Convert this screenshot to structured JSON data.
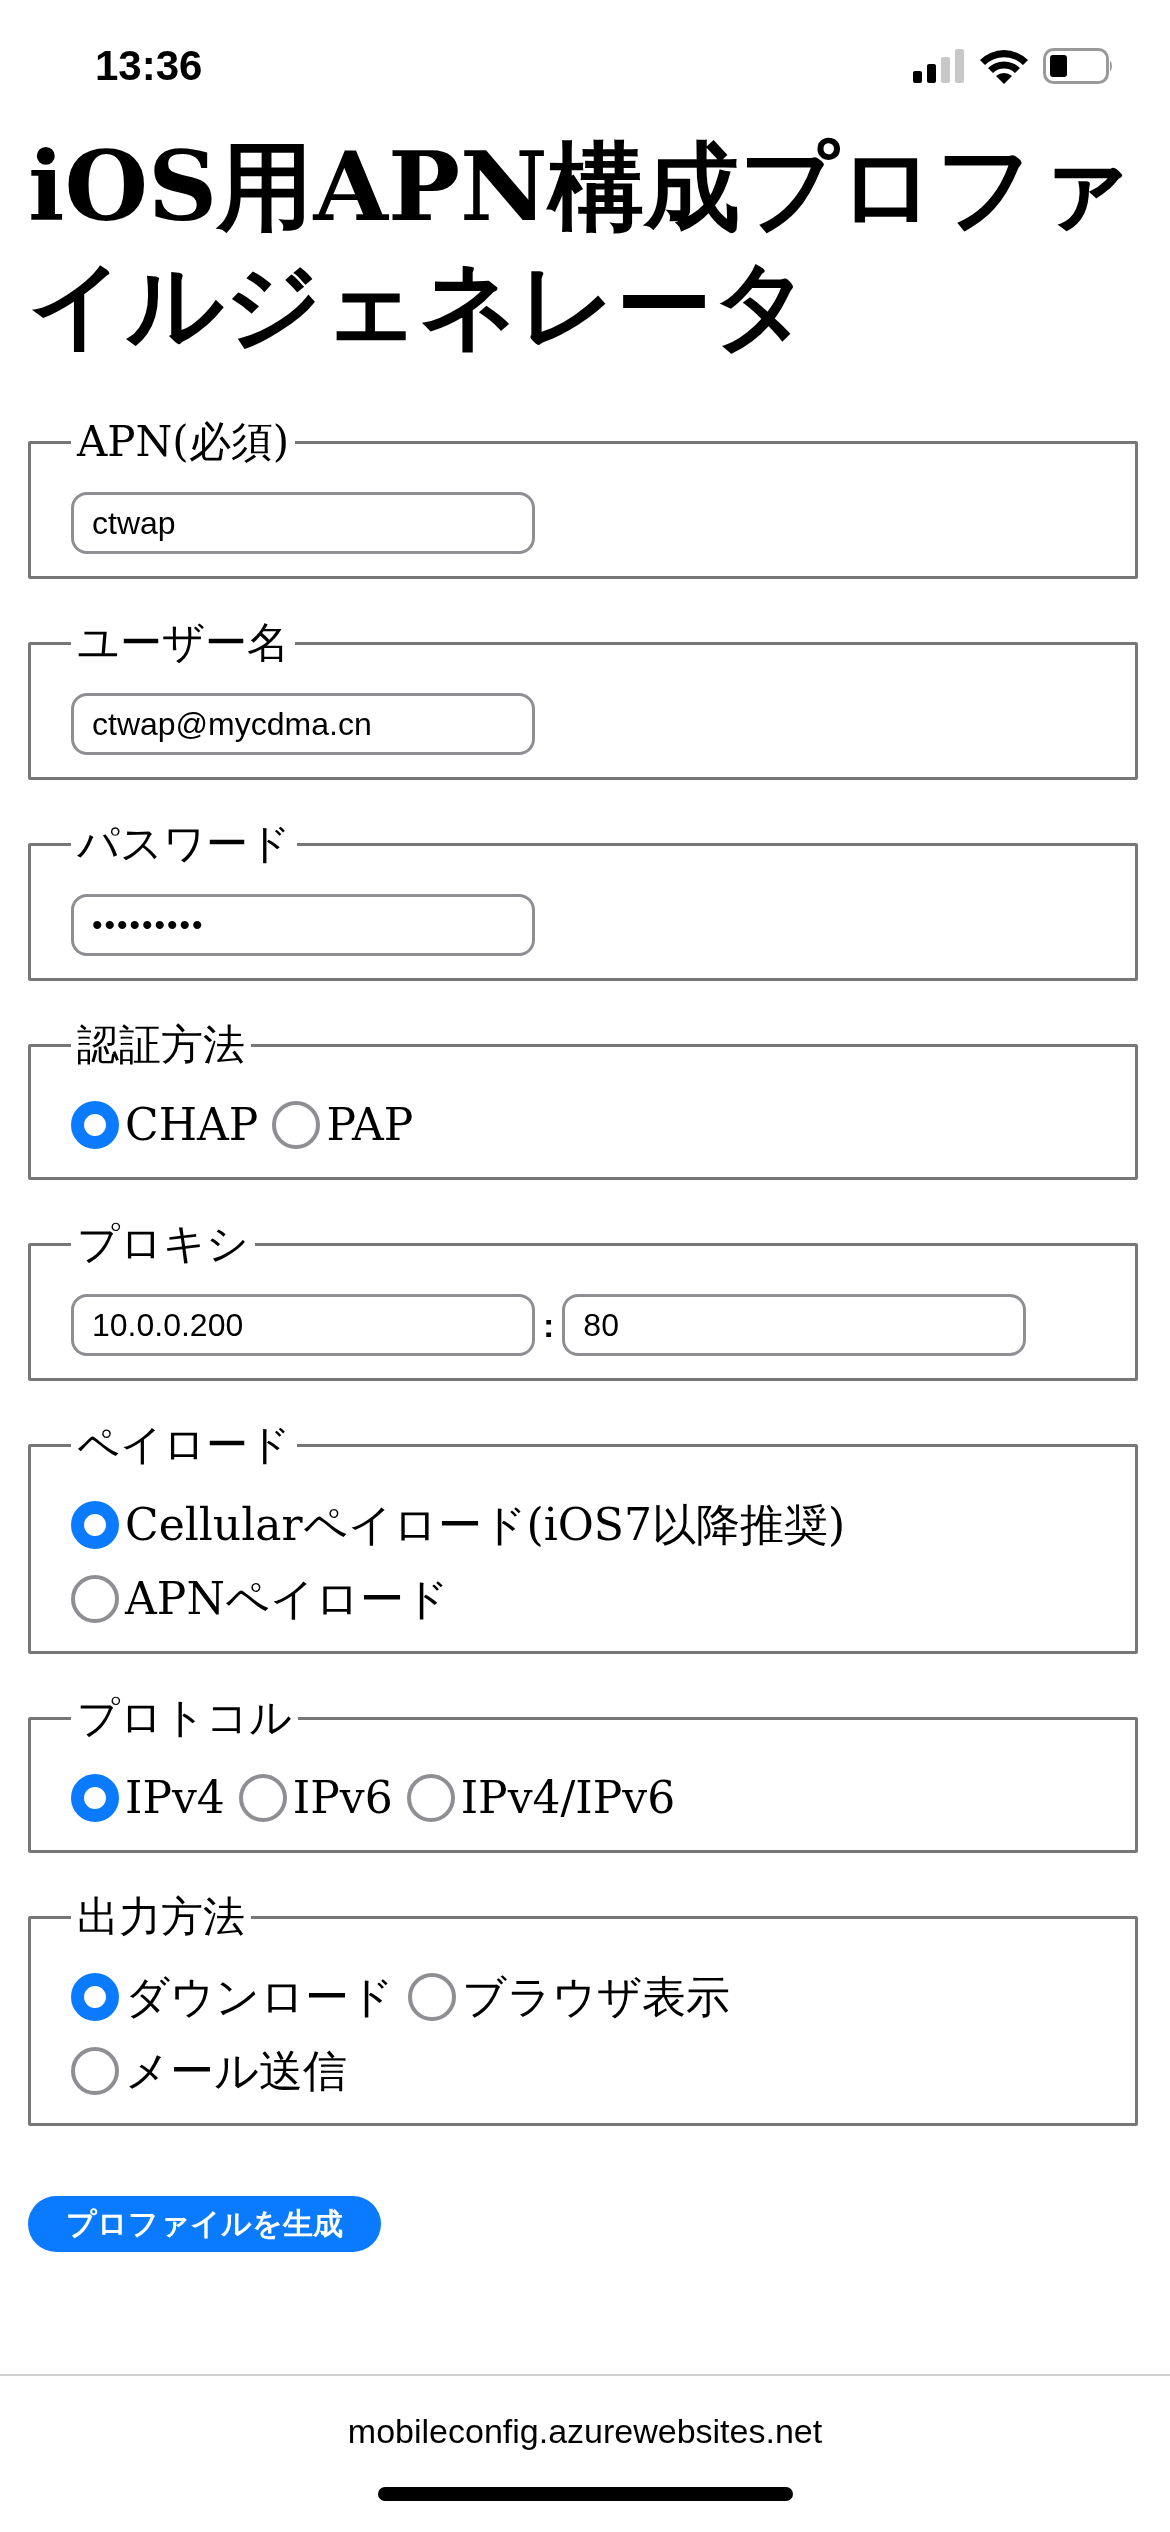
{
  "status_bar": {
    "time": "13:36"
  },
  "title_lines": [
    "iOS用APN構成プロファ",
    "イルジェネレータ"
  ],
  "sections": [
    {
      "kind": "text",
      "legend": "APN(必須)",
      "value": "ctwap"
    },
    {
      "kind": "text",
      "legend": "ユーザー名",
      "value": "ctwap@mycdma.cn"
    },
    {
      "kind": "password",
      "legend": "パスワード",
      "value": "•••••••••"
    },
    {
      "kind": "radio",
      "legend": "認証方法",
      "options": [
        {
          "label": "CHAP",
          "selected": true
        },
        {
          "label": "PAP",
          "selected": false
        }
      ]
    },
    {
      "kind": "proxy",
      "legend": "プロキシ",
      "host": "10.0.0.200",
      "separator": ":",
      "port": "80"
    },
    {
      "kind": "radio",
      "legend": "ペイロード",
      "options": [
        {
          "label": "Cellularペイロード(iOS7以降推奨)",
          "selected": true
        },
        {
          "label": "APNペイロード",
          "selected": false
        }
      ]
    },
    {
      "kind": "radio",
      "legend": "プロトコル",
      "options": [
        {
          "label": "IPv4",
          "selected": true
        },
        {
          "label": "IPv6",
          "selected": false
        },
        {
          "label": "IPv4/IPv6",
          "selected": false
        }
      ]
    },
    {
      "kind": "radio",
      "legend": "出力方法",
      "options": [
        {
          "label": "ダウンロード",
          "selected": true
        },
        {
          "label": "ブラウザ表示",
          "selected": false
        },
        {
          "label": "メール送信",
          "selected": false
        }
      ]
    }
  ],
  "submit_button": "プロファイルを生成",
  "footer": {
    "url": "mobileconfig.azurewebsites.net"
  }
}
